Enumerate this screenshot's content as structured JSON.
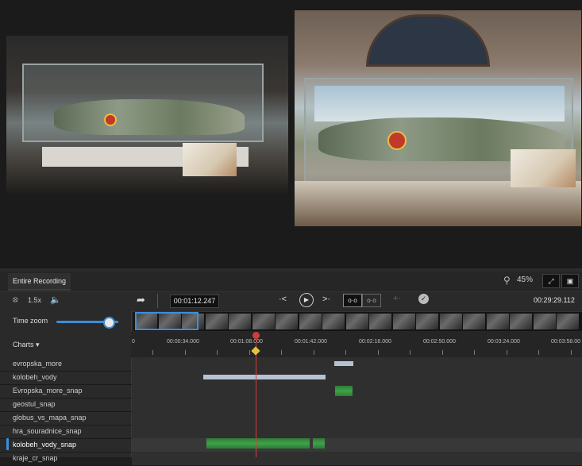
{
  "recording_tab": {
    "label": "Entire Recording"
  },
  "view_controls": {
    "zoom": "45%",
    "fit_label": "⤢",
    "fullscreen_label": "▣"
  },
  "toolbar": {
    "speed": "1.5x",
    "current_time": "00:01:12.247",
    "total_time": "00:29:29.112",
    "mark_in": "o·o",
    "mark_out": "o·o"
  },
  "time_zoom": {
    "label": "Time zoom",
    "level_fraction": 0.85
  },
  "charts": {
    "label": "Charts ▾"
  },
  "ruler": {
    "labels": [
      "0",
      "00:00:34.000",
      "00:01:08.000",
      "00:01:42.000",
      "00:02:16.000",
      "00:02:50.000",
      "00:03:24.000",
      "00:03:58.00"
    ]
  },
  "tracks": [
    {
      "name": "evropska_more"
    },
    {
      "name": "kolobeh_vody"
    },
    {
      "name": "Evropska_more_snap"
    },
    {
      "name": "geostul_snap"
    },
    {
      "name": "globus_vs_mapa_snap"
    },
    {
      "name": "hra_souradnice_snap"
    },
    {
      "name": "kolobeh_vody_snap"
    },
    {
      "name": "kraje_cr_snap"
    }
  ],
  "colors": {
    "accent": "#3b8fd9",
    "playhead": "#d43b3b",
    "marker": "#e2c13c",
    "clip_gray": "#b6c2d4",
    "clip_green": "#3fa24a"
  }
}
